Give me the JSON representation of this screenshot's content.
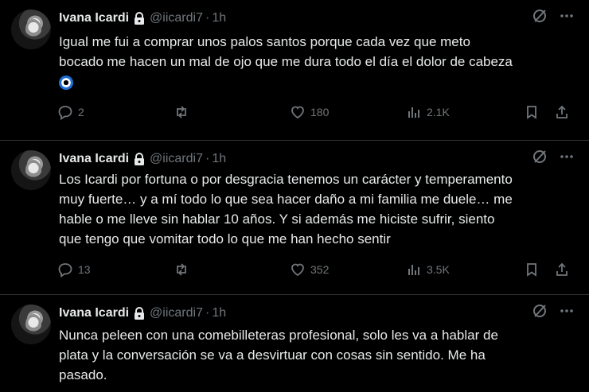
{
  "tweets": [
    {
      "author": {
        "name": "Ivana Icardi",
        "handle": "@iicardi7",
        "time": "1h"
      },
      "text_lines": [
        "Igual me fui a comprar unos palos santos porque cada vez que meto",
        "bocado me hacen un mal de ojo que me dura todo el día el dolor de cabeza"
      ],
      "emoji": "nazar-amulet",
      "stats": {
        "replies": "2",
        "retweets": "",
        "likes": "180",
        "views": "2.1K"
      }
    },
    {
      "author": {
        "name": "Ivana Icardi",
        "handle": "@iicardi7",
        "time": "1h"
      },
      "text_lines": [
        "Los Icardi por fortuna o por desgracia tenemos un carácter y temperamento",
        "muy fuerte… y a mí todo lo que sea hacer daño a mi familia me duele… me",
        "hable o me lleve sin hablar 10 años. Y si además me hiciste sufrir, siento",
        "que tengo que vomitar todo lo que me han hecho sentir"
      ],
      "stats": {
        "replies": "13",
        "retweets": "",
        "likes": "352",
        "views": "3.5K"
      }
    },
    {
      "author": {
        "name": "Ivana Icardi",
        "handle": "@iicardi7",
        "time": "1h"
      },
      "text_lines": [
        "Nunca peleen con una comebilleteras profesional, solo les va a hablar de",
        "plata y la conversación se va a desvirtuar con cosas sin sentido. Me ha",
        "pasado."
      ]
    }
  ],
  "separator": "·",
  "icons": {
    "lock": "lock-icon",
    "grok": "grok-icon",
    "more": "more-icon",
    "reply": "reply-icon",
    "retweet": "retweet-icon",
    "like": "heart-icon",
    "views": "views-icon",
    "bookmark": "bookmark-icon",
    "share": "share-icon"
  },
  "colors": {
    "background": "#000000",
    "text": "#e7e9ea",
    "muted": "#71767b",
    "divider": "#2f3336"
  }
}
